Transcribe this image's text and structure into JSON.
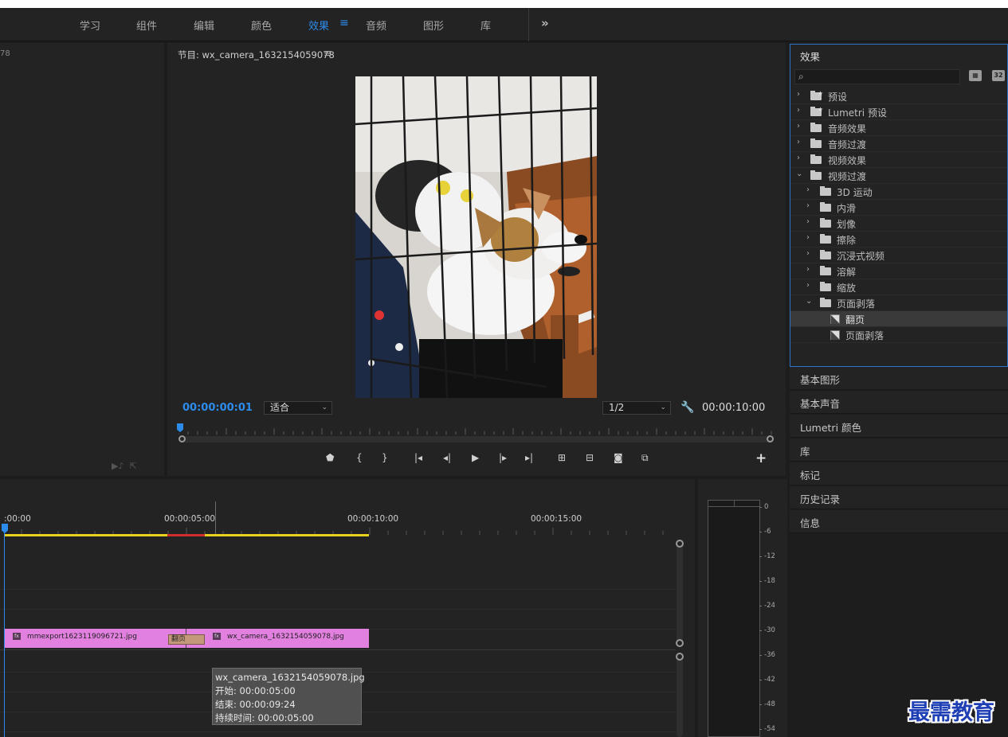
{
  "workspaces": {
    "tabs": [
      {
        "label": "学习"
      },
      {
        "label": "组件"
      },
      {
        "label": "编辑"
      },
      {
        "label": "颜色"
      },
      {
        "label": "效果"
      },
      {
        "label": "音频"
      },
      {
        "label": "图形"
      },
      {
        "label": "库"
      }
    ],
    "active": "效果",
    "menu_icon": "hamburger-icon",
    "more_icon": "double-chevron-icon",
    "more_label": "»"
  },
  "source_panel": {
    "title_fragment": "78",
    "icons": [
      "insert-icon",
      "export-frame-icon"
    ]
  },
  "program": {
    "title": "节目: wx_camera_1632154059078",
    "menu_label": "≡",
    "current_timecode": "00:00:00:01",
    "fit_select": "适合",
    "resolution_select": "1/2",
    "duration_timecode": "00:00:10:00",
    "controls": [
      {
        "name": "add-marker",
        "glyph": "⬟"
      },
      {
        "name": "mark-in",
        "glyph": "{"
      },
      {
        "name": "mark-out",
        "glyph": "}"
      },
      {
        "name": "go-to-in",
        "glyph": "|◂"
      },
      {
        "name": "step-back",
        "glyph": "◂|"
      },
      {
        "name": "play",
        "glyph": "▶"
      },
      {
        "name": "step-forward",
        "glyph": "|▸"
      },
      {
        "name": "go-to-out",
        "glyph": "▸|"
      },
      {
        "name": "lift",
        "glyph": "⊞"
      },
      {
        "name": "extract",
        "glyph": "⊟"
      },
      {
        "name": "export-frame",
        "glyph": "◙"
      },
      {
        "name": "compare",
        "glyph": "⧉"
      }
    ],
    "add_label": "+"
  },
  "effects_panel": {
    "title": "效果",
    "search_placeholder": "",
    "buttons": [
      "accelerated-icon",
      "32-bit-icon"
    ],
    "button_labels": [
      "▦",
      "32"
    ],
    "tree": [
      {
        "label": "预设",
        "level": 0,
        "expanded": false,
        "kind": "preset-folder"
      },
      {
        "label": "Lumetri 预设",
        "level": 0,
        "expanded": false,
        "kind": "preset-folder"
      },
      {
        "label": "音频效果",
        "level": 0,
        "expanded": false,
        "kind": "folder"
      },
      {
        "label": "音频过渡",
        "level": 0,
        "expanded": false,
        "kind": "folder"
      },
      {
        "label": "视频效果",
        "level": 0,
        "expanded": false,
        "kind": "folder"
      },
      {
        "label": "视频过渡",
        "level": 0,
        "expanded": true,
        "kind": "folder"
      },
      {
        "label": "3D 运动",
        "level": 1,
        "expanded": false,
        "kind": "folder"
      },
      {
        "label": "内滑",
        "level": 1,
        "expanded": false,
        "kind": "folder"
      },
      {
        "label": "划像",
        "level": 1,
        "expanded": false,
        "kind": "folder"
      },
      {
        "label": "擦除",
        "level": 1,
        "expanded": false,
        "kind": "folder"
      },
      {
        "label": "沉浸式视频",
        "level": 1,
        "expanded": false,
        "kind": "folder"
      },
      {
        "label": "溶解",
        "level": 1,
        "expanded": false,
        "kind": "folder"
      },
      {
        "label": "缩放",
        "level": 1,
        "expanded": false,
        "kind": "folder"
      },
      {
        "label": "页面剥落",
        "level": 1,
        "expanded": true,
        "kind": "folder"
      },
      {
        "label": "翻页",
        "level": 2,
        "kind": "effect",
        "selected": true
      },
      {
        "label": "页面剥落",
        "level": 2,
        "kind": "effect",
        "selected": false
      }
    ]
  },
  "side_panels": [
    {
      "label": "基本图形"
    },
    {
      "label": "基本声音"
    },
    {
      "label": "Lumetri 颜色"
    },
    {
      "label": "库"
    },
    {
      "label": "标记"
    },
    {
      "label": "历史记录"
    },
    {
      "label": "信息"
    }
  ],
  "timeline": {
    "ruler_labels": [
      ":00:00",
      "00:00:05:00",
      "00:00:10:00",
      "00:00:15:00"
    ],
    "clips": [
      {
        "name": "mmexport1623119096721.jpg",
        "fx": "fx"
      },
      {
        "name": "wx_camera_1632154059078.jpg",
        "fx": "fx"
      }
    ],
    "transition": "翻页",
    "tooltip": {
      "name": "wx_camera_1632154059078.jpg",
      "start": "开始: 00:00:05:00",
      "end": "结束: 00:00:09:24",
      "duration": "持续时间: 00:00:05:00"
    }
  },
  "audio_meter": {
    "labels": [
      "0",
      "-6",
      "-12",
      "-18",
      "-24",
      "-30",
      "-36",
      "-42",
      "-48",
      "-54"
    ]
  },
  "watermark": "最需教育",
  "colors": {
    "accent": "#2d8ceb",
    "clip": "#e280e0",
    "transition": "#c4987a",
    "work_area": "#e8d21e",
    "render_red": "#d22d2d"
  }
}
